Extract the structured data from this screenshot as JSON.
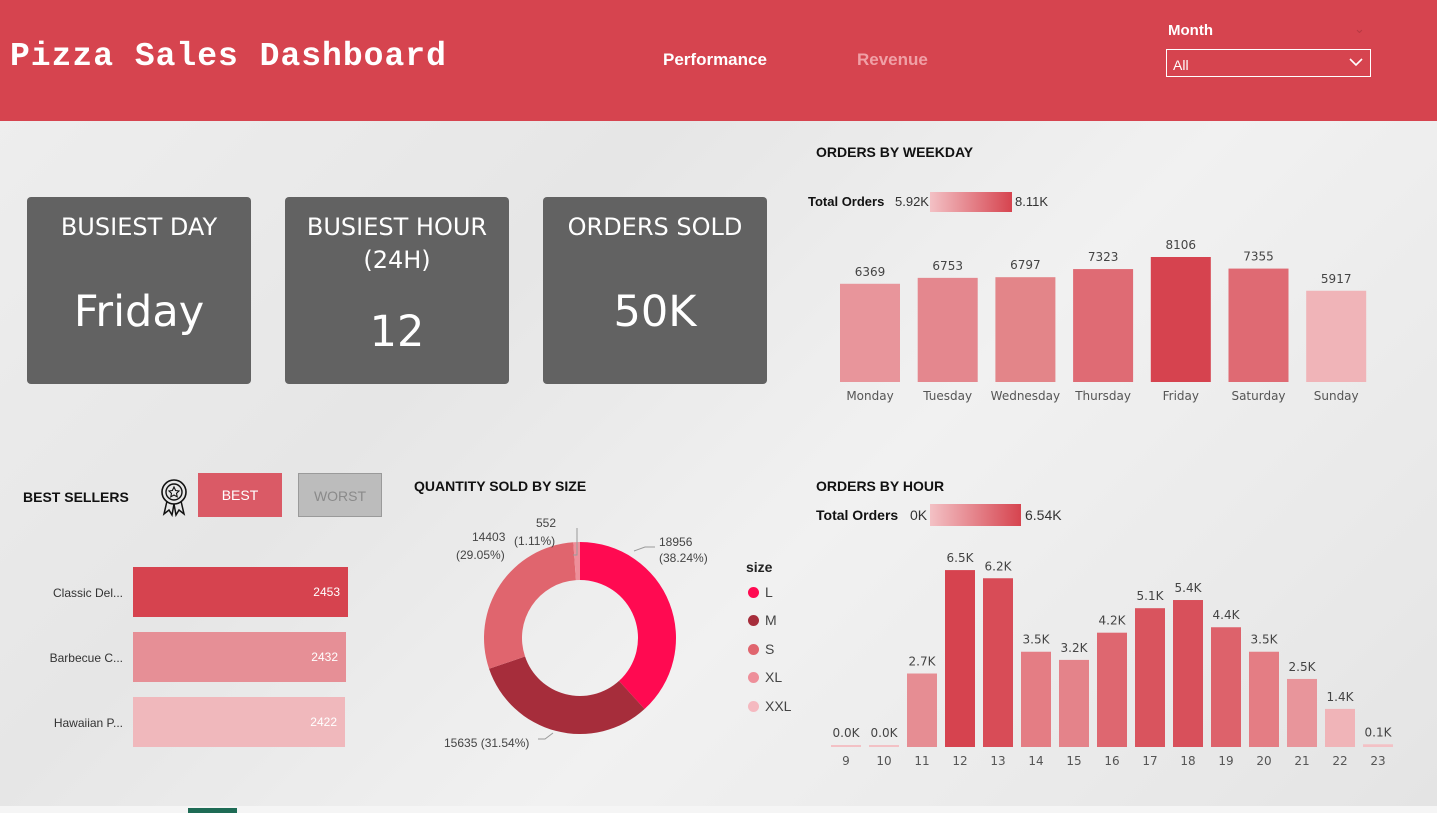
{
  "header": {
    "title": "Pizza Sales Dashboard",
    "tabs": [
      "Performance",
      "Revenue"
    ],
    "month_label": "Month",
    "month_value": "All"
  },
  "kpis": [
    {
      "title_line1": "BUSIEST DAY",
      "title_line2": "",
      "value": "Friday"
    },
    {
      "title_line1": "BUSIEST HOUR",
      "title_line2": "(24H)",
      "value": "12"
    },
    {
      "title_line1": "ORDERS SOLD",
      "title_line2": "",
      "value": "50K"
    }
  ],
  "best_sellers": {
    "title": "BEST SELLERS",
    "best_label": "BEST",
    "worst_label": "WORST",
    "items": [
      {
        "name": "Classic Del...",
        "value": "2453",
        "color": "#d6434f"
      },
      {
        "name": "Barbecue C...",
        "value": "2432",
        "color": "#e68f96"
      },
      {
        "name": "Hawaiian P...",
        "value": "2422",
        "color": "#f0b8bc"
      }
    ]
  },
  "chart_data": [
    {
      "type": "bar",
      "title": "ORDERS BY WEEKDAY",
      "legend": {
        "label": "Total Orders",
        "min": "5.92K",
        "max": "8.11K"
      },
      "categories": [
        "Monday",
        "Tuesday",
        "Wednesday",
        "Thursday",
        "Friday",
        "Saturday",
        "Sunday"
      ],
      "values": [
        6369,
        6753,
        6797,
        7323,
        8106,
        7355,
        5917
      ],
      "labels": [
        "6369",
        "6753",
        "6797",
        "7323",
        "8106",
        "7355",
        "5917"
      ],
      "ylim": [
        0,
        8106
      ],
      "colors": [
        "#e8959b",
        "#e4878e",
        "#e38589",
        "#df6b74",
        "#d6434f",
        "#df6a73",
        "#f0b4b8"
      ]
    },
    {
      "type": "bar",
      "title": "ORDERS BY HOUR",
      "legend": {
        "label": "Total Orders",
        "min": "0K",
        "max": "6.54K"
      },
      "categories": [
        "9",
        "10",
        "11",
        "12",
        "13",
        "14",
        "15",
        "16",
        "17",
        "18",
        "19",
        "20",
        "21",
        "22",
        "23"
      ],
      "values": [
        0.0,
        0.0,
        2.7,
        6.5,
        6.2,
        3.5,
        3.2,
        4.2,
        5.1,
        5.4,
        4.4,
        3.5,
        2.5,
        1.4,
        0.1
      ],
      "labels": [
        "0.0K",
        "0.0K",
        "2.7K",
        "6.5K",
        "6.2K",
        "3.5K",
        "3.2K",
        "4.2K",
        "5.1K",
        "5.4K",
        "4.4K",
        "3.5K",
        "2.5K",
        "1.4K",
        "0.1K"
      ],
      "colors": [
        "#f3c1c5",
        "#f3c1c5",
        "#e68d93",
        "#d6434f",
        "#d84c57",
        "#e47d84",
        "#e4838a",
        "#de6770",
        "#d9545e",
        "#d8505b",
        "#dd626b",
        "#e47d84",
        "#e8959b",
        "#f0b4b8",
        "#f3c1c5"
      ]
    },
    {
      "type": "pie",
      "title": "QUANTITY SOLD BY SIZE",
      "legend_title": "size",
      "categories": [
        "L",
        "M",
        "S",
        "XL",
        "XXL"
      ],
      "values": [
        18956,
        15635,
        14403,
        552,
        0
      ],
      "percents": [
        "38.24%",
        "31.54%",
        "29.05%",
        "1.11%",
        ""
      ],
      "colors": [
        "#ff0a51",
        "#a62d3b",
        "#e0656e",
        "#ee8f9a",
        "#f5b9c0"
      ],
      "labels": [
        {
          "value": "18956",
          "pct": "(38.24%)"
        },
        {
          "value": "15635 (31.54%)",
          "pct": ""
        },
        {
          "value": "14403",
          "pct": "(29.05%)"
        },
        {
          "value": "552",
          "pct": "(1.11%)"
        }
      ]
    }
  ]
}
